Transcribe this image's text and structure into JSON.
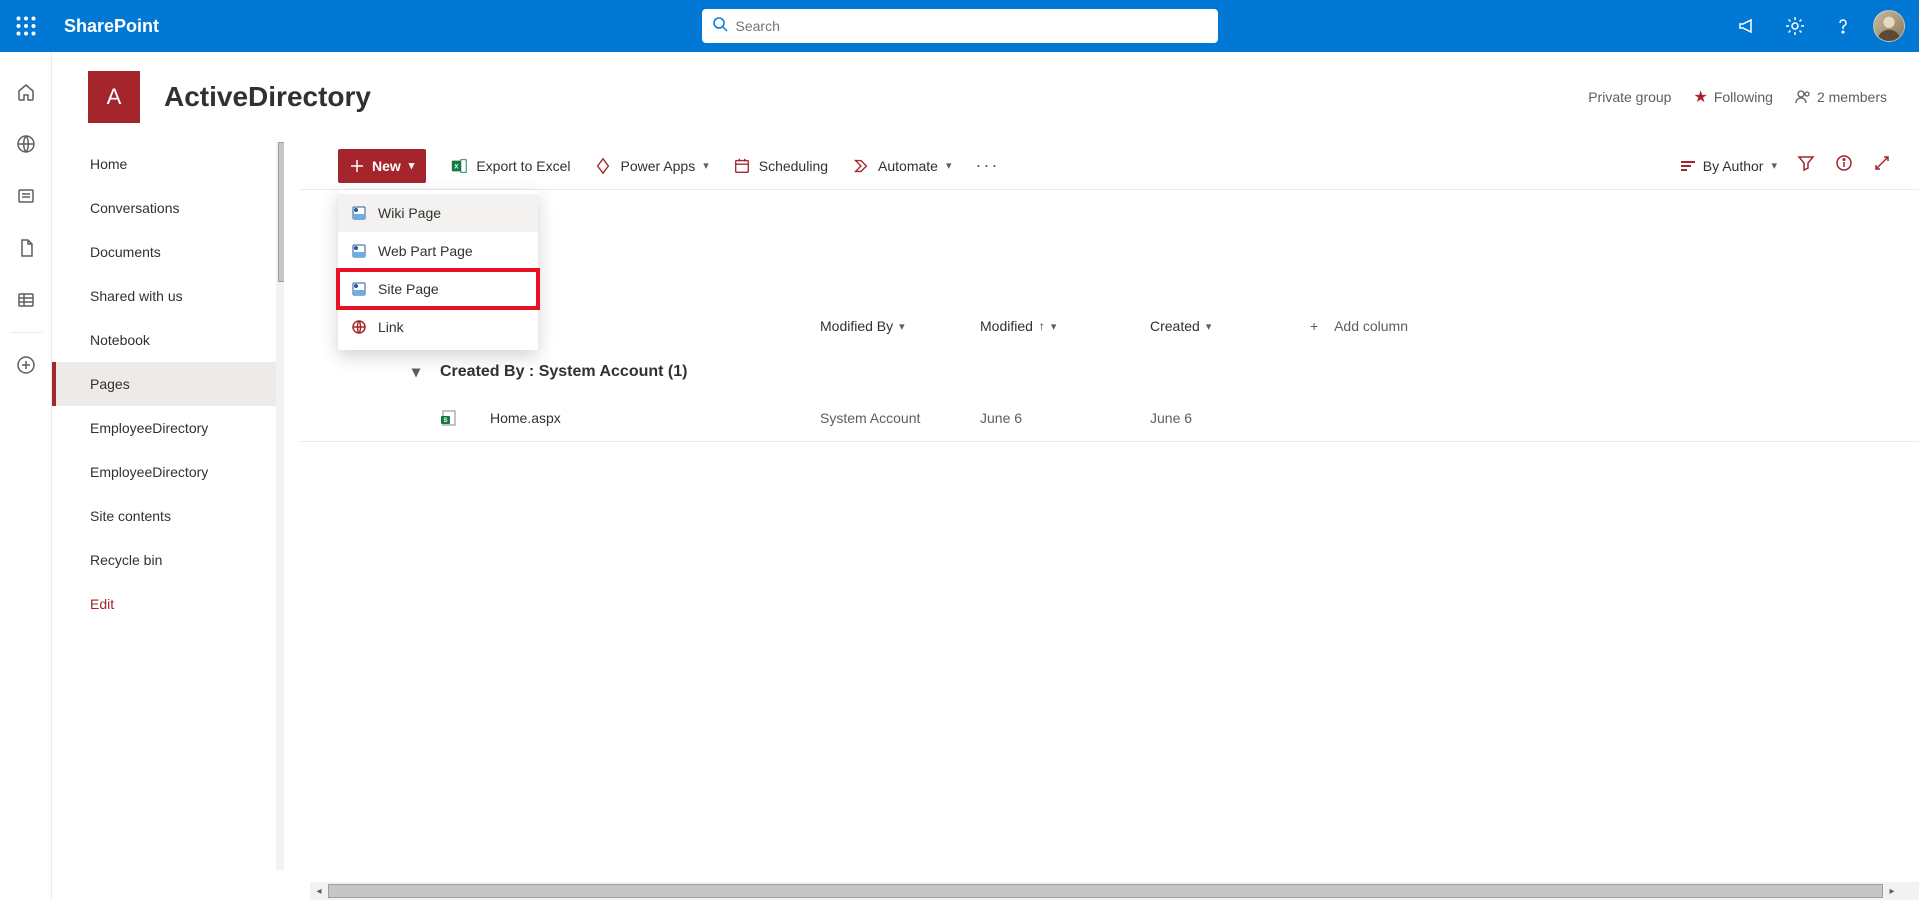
{
  "suite": {
    "brand": "SharePoint",
    "search_placeholder": "Search"
  },
  "site": {
    "logo_letter": "A",
    "title": "ActiveDirectory",
    "privacy": "Private group",
    "following": "Following",
    "members": "2 members"
  },
  "nav": {
    "items": [
      "Home",
      "Conversations",
      "Documents",
      "Shared with us",
      "Notebook",
      "Pages",
      "EmployeeDirectory",
      "EmployeeDirectory",
      "Site contents",
      "Recycle bin"
    ],
    "edit": "Edit",
    "active_index": 5
  },
  "cmd": {
    "new": "New",
    "export": "Export to Excel",
    "powerapps": "Power Apps",
    "scheduling": "Scheduling",
    "automate": "Automate",
    "sort_by": "By Author"
  },
  "new_menu": [
    "Wiki Page",
    "Web Part Page",
    "Site Page",
    "Link"
  ],
  "new_menu_highlight_index": 2,
  "columns": {
    "modified_by": "Modified By",
    "modified": "Modified",
    "created": "Created",
    "add": "Add column"
  },
  "group": {
    "label": "Created By : System Account (1)"
  },
  "rows": [
    {
      "name": "Home.aspx",
      "modified_by": "System Account",
      "modified": "June 6",
      "created": "June 6"
    }
  ]
}
